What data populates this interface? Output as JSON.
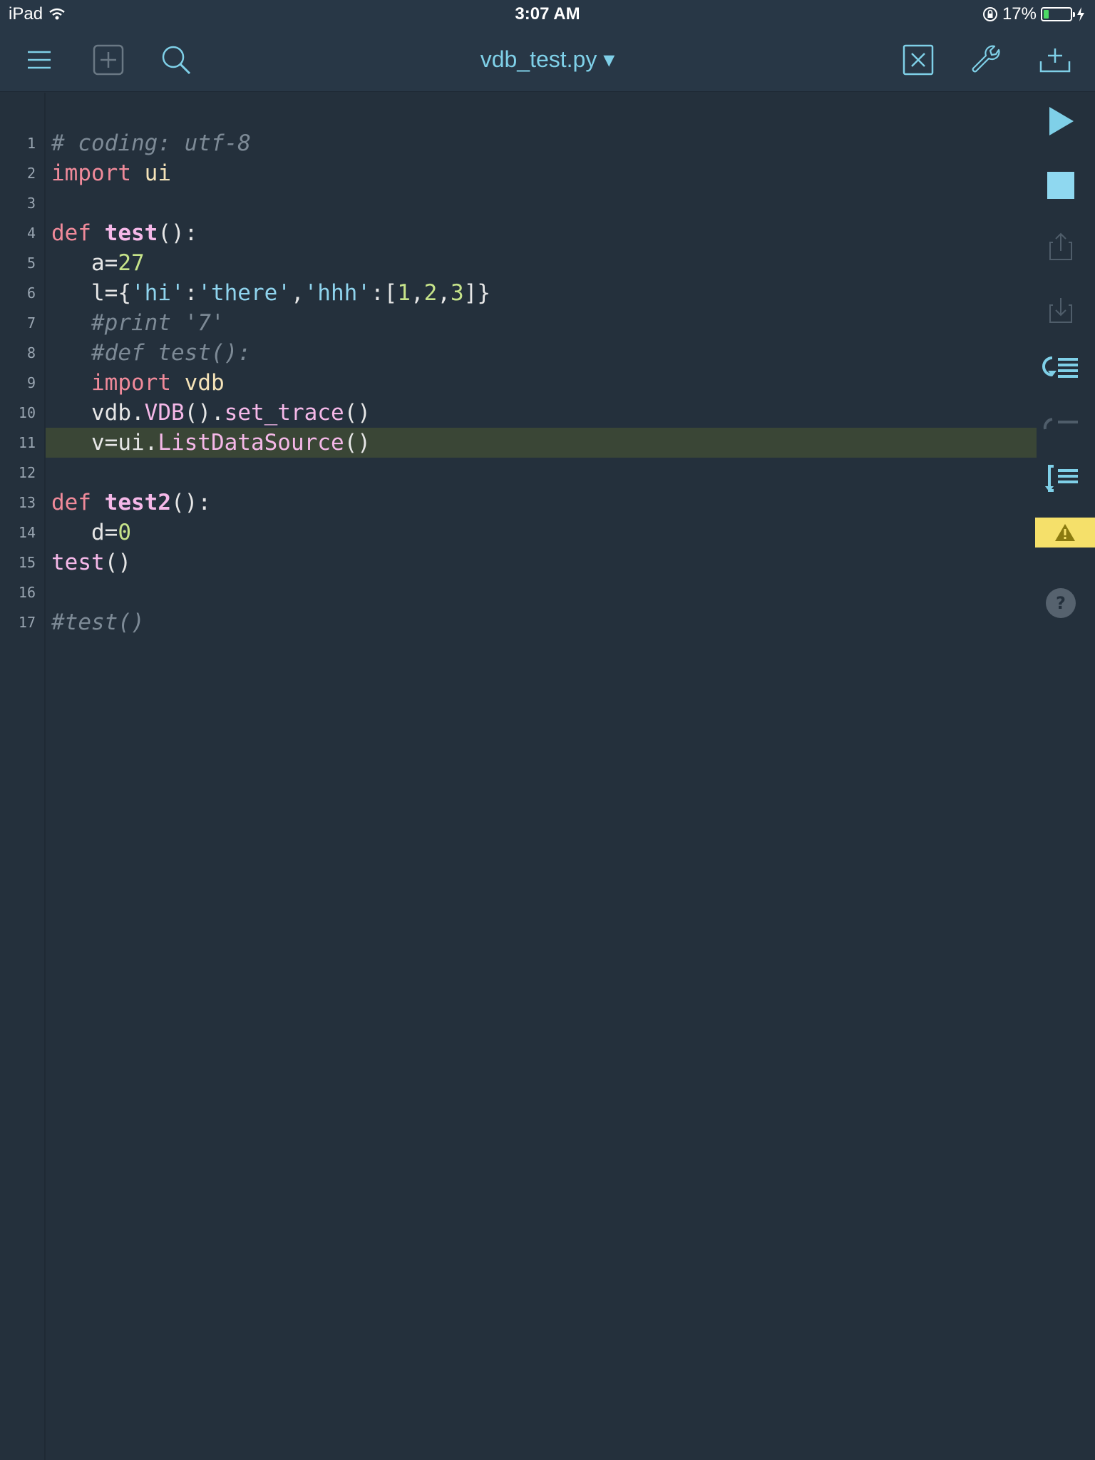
{
  "status_bar": {
    "device": "iPad",
    "time": "3:07 AM",
    "battery_percent": "17%"
  },
  "toolbar": {
    "file_title": "vdb_test.py ▾"
  },
  "editor": {
    "lines": [
      {
        "num": "1",
        "tokens": [
          {
            "t": "# coding: utf-8",
            "c": "comment"
          }
        ]
      },
      {
        "num": "2",
        "tokens": [
          {
            "t": "import",
            "c": "kw"
          },
          {
            "t": " "
          },
          {
            "t": "ui",
            "c": "mod"
          }
        ]
      },
      {
        "num": "3",
        "tokens": []
      },
      {
        "num": "4",
        "tokens": [
          {
            "t": "def",
            "c": "kw"
          },
          {
            "t": " "
          },
          {
            "t": "test",
            "c": "fn"
          },
          {
            "t": "():",
            "c": "punc"
          }
        ]
      },
      {
        "num": "5",
        "tokens": [
          {
            "t": "   a="
          },
          {
            "t": "27",
            "c": "num"
          }
        ]
      },
      {
        "num": "6",
        "tokens": [
          {
            "t": "   l={"
          },
          {
            "t": "'hi'",
            "c": "str"
          },
          {
            "t": ":"
          },
          {
            "t": "'there'",
            "c": "str"
          },
          {
            "t": ","
          },
          {
            "t": "'hhh'",
            "c": "str"
          },
          {
            "t": ":["
          },
          {
            "t": "1",
            "c": "num"
          },
          {
            "t": ","
          },
          {
            "t": "2",
            "c": "num"
          },
          {
            "t": ","
          },
          {
            "t": "3",
            "c": "num"
          },
          {
            "t": "]}"
          }
        ]
      },
      {
        "num": "7",
        "tokens": [
          {
            "t": "   #print '7'",
            "c": "comment"
          }
        ]
      },
      {
        "num": "8",
        "tokens": [
          {
            "t": "   #def test():",
            "c": "comment"
          }
        ]
      },
      {
        "num": "9",
        "tokens": [
          {
            "t": "   "
          },
          {
            "t": "import",
            "c": "kw"
          },
          {
            "t": " "
          },
          {
            "t": "vdb",
            "c": "mod"
          }
        ]
      },
      {
        "num": "10",
        "tokens": [
          {
            "t": "   vdb."
          },
          {
            "t": "VDB",
            "c": "call"
          },
          {
            "t": "()."
          },
          {
            "t": "set_trace",
            "c": "call"
          },
          {
            "t": "()"
          }
        ]
      },
      {
        "num": "11",
        "tokens": [
          {
            "t": "   v=ui."
          },
          {
            "t": "ListDataSource",
            "c": "call"
          },
          {
            "t": "()"
          }
        ],
        "highlighted": true
      },
      {
        "num": "12",
        "tokens": []
      },
      {
        "num": "13",
        "tokens": [
          {
            "t": "def",
            "c": "kw"
          },
          {
            "t": " "
          },
          {
            "t": "test2",
            "c": "fn"
          },
          {
            "t": "():",
            "c": "punc"
          }
        ]
      },
      {
        "num": "14",
        "tokens": [
          {
            "t": "   d="
          },
          {
            "t": "0",
            "c": "num"
          }
        ]
      },
      {
        "num": "15",
        "tokens": [
          {
            "t": "test",
            "c": "call"
          },
          {
            "t": "()"
          }
        ]
      },
      {
        "num": "16",
        "tokens": []
      },
      {
        "num": "17",
        "tokens": [
          {
            "t": "#test()",
            "c": "comment"
          }
        ]
      }
    ]
  },
  "side_panel": {
    "warning_count": "1"
  },
  "colors": {
    "background": "#24303c",
    "accent": "#7fd0e8",
    "warning": "#f5e06a",
    "highlight_line": "#3a4636"
  },
  "icons": [
    "menu-icon",
    "add-square-icon",
    "search-icon",
    "close-square-icon",
    "wrench-icon",
    "add-to-list-icon",
    "play-icon",
    "stop-icon",
    "upload-icon",
    "download-icon",
    "step-over-icon",
    "step-into-icon",
    "step-out-icon",
    "glasses-icon",
    "help-icon",
    "warning-icon"
  ]
}
